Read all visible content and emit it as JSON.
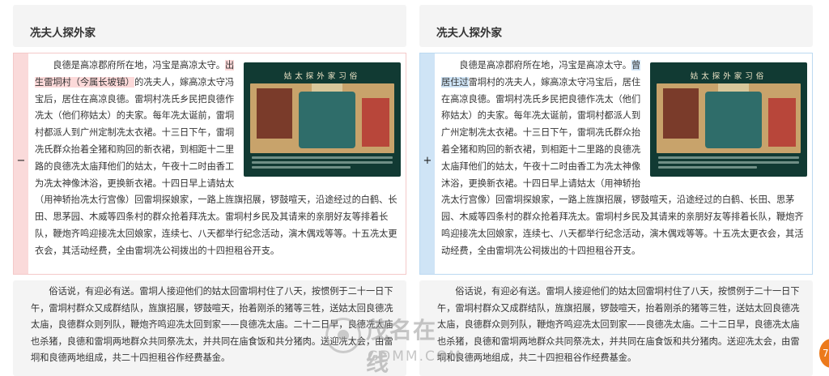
{
  "left": {
    "title": "冼夫人探外家",
    "marker": "−",
    "content_pre": "　　良德是高凉郡府所在地，冯宝是高凉太守。",
    "highlight": "出生雷垌村（今属长坡镇）",
    "content_post": "的冼夫人，嫁高凉太守冯宝后，居住在高凉良德。雷垌村冼氏乡民把良德作冼太（他们称姑太）的夫家。每年冼太诞前，雷垌村都派人到广州定制冼太衣裙。十三日下午，雷垌冼氏群众抬着全猪和购回的新衣裙，到相距十二里路的良德冼太庙拜他们的姑太，午夜十二时由香工为冼太神像沐浴，更换新衣裙。十四日早上请姑太（用神轿抬冼太行宫像）回雷垌探娘家，一路上旌旗招展，锣鼓喧天，沿途经过的白鹤、长田、思茅园、木威等四条村的群众抢着拜冼太。雷垌村乡民及其请来的亲朋好友等排着长队，鞭炮齐鸣迎接冼太回娘家，连续七、八天都举行纪念活动，演木偶戏等等。十五冼太更衣会，其活动经费，全由雷垌冼公祠拨出的十四担租谷开支。",
    "paragraph": "　　俗话说，有迎必有送。雷垌人接迎他们的姑太回雷垌村住了八天，按惯例于二十一日下午，雷垌村群众又成群结队，旌旗招展，锣鼓喧天，抬着刚杀的猪等三牲，送姑太回良德冼太庙，良德群众则列队，鞭炮齐鸣迎冼太回到家——良德冼太庙。二十二日早，良德冼太庙也杀猪，良德和雷垌两地群众共同祭冼太，并共同在庙食饭和共分猪肉。送迎冼太会，由雷垌和良德两地组成，共二十四担租谷作经费基金。"
  },
  "right": {
    "title": "冼夫人探外家",
    "marker": "+",
    "content_pre": "　　良德是高凉郡府所在地，冯宝是高凉太守。",
    "highlight": "曾居住过",
    "content_post": "雷垌村的冼夫人，嫁高凉太守冯宝后，居住在高凉良德。雷垌村冼氏乡民把良德作冼太（他们称姑太）的夫家。每年冼太诞前，雷垌村都派人到广州定制冼太衣裙。十三日下午，雷垌冼氏群众抬着全猪和购回的新衣裙，到相距十二里路的良德冼太庙拜他们的姑太，午夜十二时由香工为冼太神像沐浴，更换新衣裙。十四日早上请姑太（用神轿抬冼太行宫像）回雷垌探娘家，一路上旌旗招展，锣鼓喧天，沿途经过的白鹤、长田、思茅园、木威等四条村的群众抢着拜冼太。雷垌村乡民及其请来的亲朋好友等排着长队，鞭炮齐鸣迎接冼太回娘家，连续七、八天都举行纪念活动，演木偶戏等等。十五冼太更衣会，其活动经费，全由雷垌冼公祠拨出的十四担租谷开支。",
    "paragraph": "　　俗话说，有迎必有送。雷垌人接迎他们的姑太回雷垌村住了八天，按惯例于二十一日下午，雷垌村群众又成群结队，旌旗招展，锣鼓喧天，抬着刚杀的猪等三牲，送姑太回良德冼太庙，良德群众则列队，鞭炮齐鸣迎冼太回到家——良德冼太庙。二十二日早，良德冼太庙也杀猪，良德和雷垌两地群众共同祭冼太，并共同在庙食饭和共分猪肉。送迎冼太会，由雷垌和良德两地组成，共二十四担租谷作经费基金。"
  },
  "image": {
    "title": "姑太探外家习俗"
  },
  "watermark": {
    "title": "茂名在线",
    "sub": "GDMM.COM"
  },
  "float_button": {
    "label": "7"
  },
  "colors": {
    "removed_bg": "#fcd9d9",
    "added_bg": "#cfe4f6",
    "accent_orange": "#ec7a1c"
  }
}
